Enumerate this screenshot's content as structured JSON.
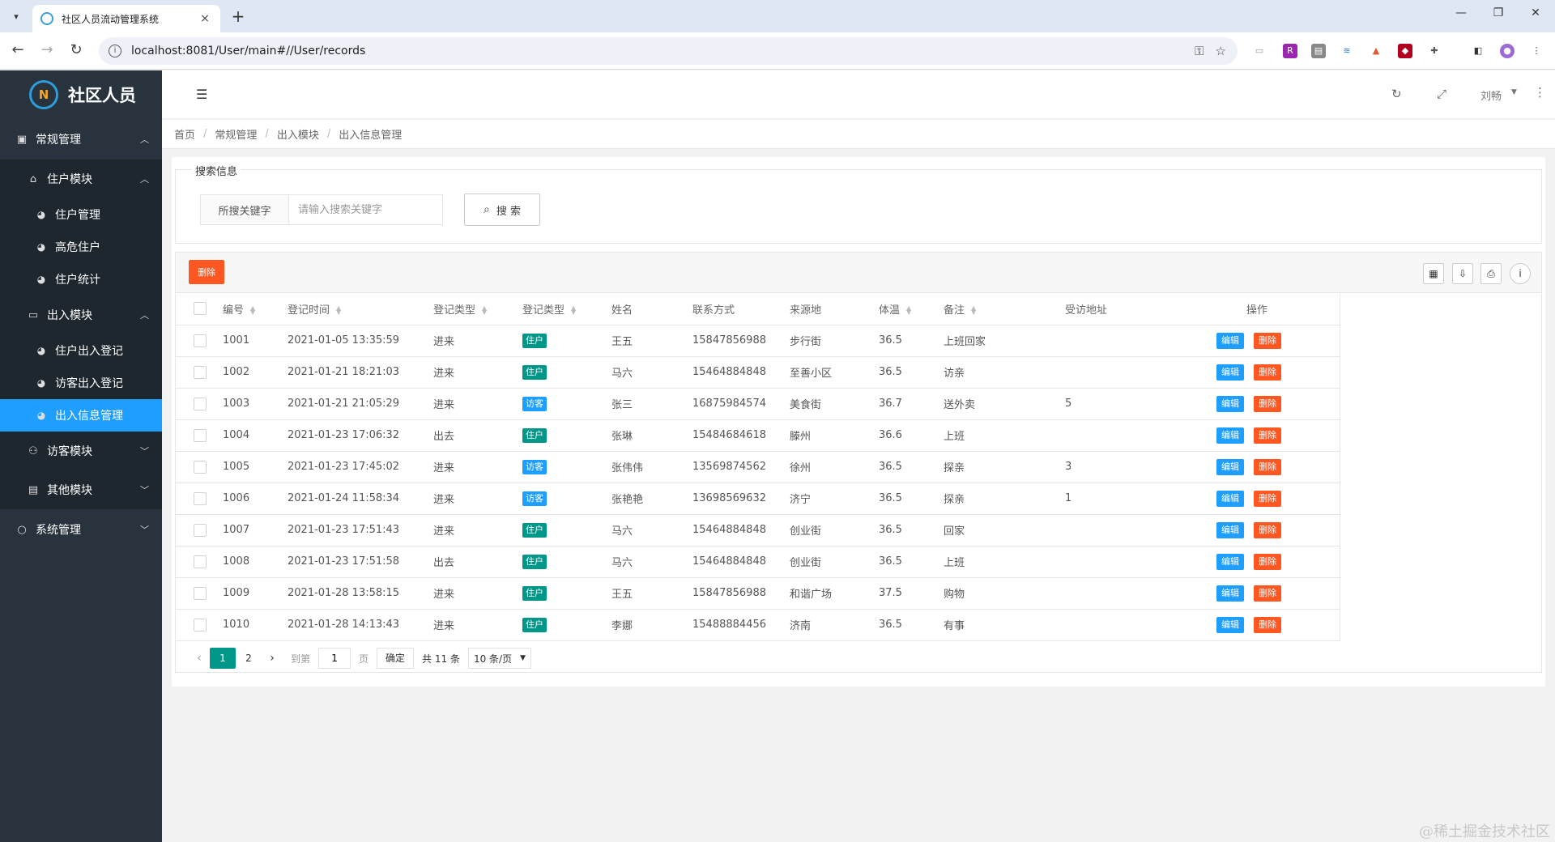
{
  "browser": {
    "tab_title": "社区人员流动管理系统",
    "url": "localhost:8081/User/main#//User/records",
    "new_tab": "+",
    "close": "×"
  },
  "app": {
    "brand": "社区人员",
    "user": "刘畅"
  },
  "sidebar": {
    "groups": [
      {
        "label": "常规管理"
      },
      {
        "label": "系统管理"
      }
    ],
    "modules": [
      {
        "label": "住户模块"
      },
      {
        "label": "出入模块"
      },
      {
        "label": "访客模块"
      },
      {
        "label": "其他模块"
      }
    ],
    "items": [
      {
        "label": "住户管理"
      },
      {
        "label": "高危住户"
      },
      {
        "label": "住户统计"
      },
      {
        "label": "住户出入登记"
      },
      {
        "label": "访客出入登记"
      },
      {
        "label": "出入信息管理"
      }
    ]
  },
  "breadcrumb": [
    "首页",
    "常规管理",
    "出入模块",
    "出入信息管理"
  ],
  "search": {
    "legend": "搜索信息",
    "label": "所搜关键字",
    "placeholder": "请输入搜索关键字",
    "value": "",
    "button": "搜 索"
  },
  "toolbar": {
    "delete": "删除"
  },
  "table": {
    "headers": [
      "编号",
      "登记时间",
      "登记类型",
      "登记类型",
      "姓名",
      "联系方式",
      "来源地",
      "体温",
      "备注",
      "受访地址",
      "操作"
    ],
    "edit_label": "编辑",
    "delete_label": "删除",
    "rows": [
      {
        "id": "1001",
        "time": "2021-01-05 13:35:59",
        "direction": "进来",
        "type": "住户",
        "name": "王五",
        "phone": "15847856988",
        "origin": "步行街",
        "temp": "36.5",
        "note": "上班回家",
        "visit": ""
      },
      {
        "id": "1002",
        "time": "2021-01-21 18:21:03",
        "direction": "进来",
        "type": "住户",
        "name": "马六",
        "phone": "15464884848",
        "origin": "至善小区",
        "temp": "36.5",
        "note": "访亲",
        "visit": ""
      },
      {
        "id": "1003",
        "time": "2021-01-21 21:05:29",
        "direction": "进来",
        "type": "访客",
        "name": "张三",
        "phone": "16875984574",
        "origin": "美食街",
        "temp": "36.7",
        "note": "送外卖",
        "visit": "5"
      },
      {
        "id": "1004",
        "time": "2021-01-23 17:06:32",
        "direction": "出去",
        "type": "住户",
        "name": "张琳",
        "phone": "15484684618",
        "origin": "滕州",
        "temp": "36.6",
        "note": "上班",
        "visit": ""
      },
      {
        "id": "1005",
        "time": "2021-01-23 17:45:02",
        "direction": "进来",
        "type": "访客",
        "name": "张伟伟",
        "phone": "13569874562",
        "origin": "徐州",
        "temp": "36.5",
        "note": "探亲",
        "visit": "3"
      },
      {
        "id": "1006",
        "time": "2021-01-24 11:58:34",
        "direction": "进来",
        "type": "访客",
        "name": "张艳艳",
        "phone": "13698569632",
        "origin": "济宁",
        "temp": "36.5",
        "note": "探亲",
        "visit": "1"
      },
      {
        "id": "1007",
        "time": "2021-01-23 17:51:43",
        "direction": "进来",
        "type": "住户",
        "name": "马六",
        "phone": "15464884848",
        "origin": "创业街",
        "temp": "36.5",
        "note": "回家",
        "visit": ""
      },
      {
        "id": "1008",
        "time": "2021-01-23 17:51:58",
        "direction": "出去",
        "type": "住户",
        "name": "马六",
        "phone": "15464884848",
        "origin": "创业街",
        "temp": "36.5",
        "note": "上班",
        "visit": ""
      },
      {
        "id": "1009",
        "time": "2021-01-28 13:58:15",
        "direction": "进来",
        "type": "住户",
        "name": "王五",
        "phone": "15847856988",
        "origin": "和谐广场",
        "temp": "37.5",
        "note": "购物",
        "visit": ""
      },
      {
        "id": "1010",
        "time": "2021-01-28 14:13:43",
        "direction": "进来",
        "type": "住户",
        "name": "李娜",
        "phone": "15488884456",
        "origin": "济南",
        "temp": "36.5",
        "note": "有事",
        "visit": ""
      }
    ]
  },
  "pager": {
    "pages": [
      "1",
      "2"
    ],
    "goto": "到第",
    "goto_value": "1",
    "page_unit": "页",
    "ok": "确定",
    "total": "共 11 条",
    "per_page": "10 条/页"
  },
  "watermark": "@稀土掘金技术社区",
  "colors": {
    "sidebar": "#28333e",
    "active": "#1e9fff",
    "danger": "#ff5722",
    "primary": "#009688"
  }
}
